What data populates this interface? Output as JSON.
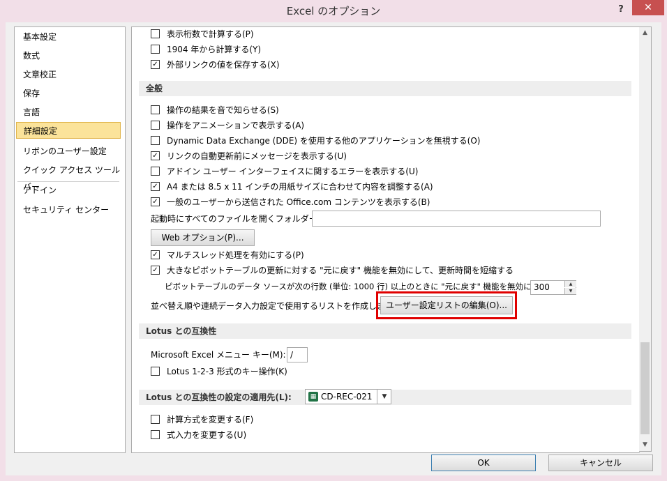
{
  "window": {
    "title": "Excel のオプション",
    "help": "?",
    "close": "✕"
  },
  "sidebar": {
    "items": [
      {
        "label": "基本設定"
      },
      {
        "label": "数式"
      },
      {
        "label": "文章校正"
      },
      {
        "label": "保存"
      },
      {
        "label": "言語"
      },
      {
        "label": "詳細設定",
        "selected": true
      },
      {
        "label": "リボンのユーザー設定"
      },
      {
        "label": "クイック アクセス ツール バー"
      },
      {
        "label": "アドイン"
      },
      {
        "label": "セキュリティ センター"
      }
    ]
  },
  "options_top": [
    {
      "label": "表示桁数で計算する(P)",
      "checked": false
    },
    {
      "label": "1904 年から計算する(Y)",
      "checked": false
    },
    {
      "label": "外部リンクの値を保存する(X)",
      "checked": true
    }
  ],
  "general": {
    "header": "全般",
    "options": [
      {
        "label": "操作の結果を音で知らせる(S)",
        "checked": false
      },
      {
        "label": "操作をアニメーションで表示する(A)",
        "checked": false
      },
      {
        "label": "Dynamic Data Exchange (DDE) を使用する他のアプリケーションを無視する(O)",
        "checked": false
      },
      {
        "label": "リンクの自動更新前にメッセージを表示する(U)",
        "checked": true
      },
      {
        "label": "アドイン ユーザー インターフェイスに関するエラーを表示する(U)",
        "checked": false
      },
      {
        "label": "A4 または 8.5 x 11 インチの用紙サイズに合わせて内容を調整する(A)",
        "checked": true
      },
      {
        "label": "一般のユーザーから送信された Office.com コンテンツを表示する(B)",
        "checked": true
      }
    ],
    "startup_folder_label": "起動時にすべてのファイルを開くフォルダー(L):",
    "startup_folder_value": "",
    "web_options_button": "Web オプション(P)...",
    "multithread": {
      "label": "マルチスレッド処理を有効にする(P)",
      "checked": true
    },
    "pivot_undo": {
      "label": "大きなピボットテーブルの更新に対する \"元に戻す\" 機能を無効にして、更新時間を短縮する",
      "checked": true
    },
    "pivot_rows_label": "ピボットテーブルのデータ ソースが次の行数 (単位: 1000 行) 以上のときに \"元に戻す\" 機能を無効にする:",
    "pivot_rows_value": "300",
    "custom_list_label": "並べ替え順や連続データ入力設定で使用するリストを作成します:",
    "custom_list_button": "ユーザー設定リストの編集(O)..."
  },
  "lotus": {
    "header": "Lotus との互換性",
    "menu_key_label": "Microsoft Excel メニュー キー(M):",
    "menu_key_value": "/",
    "transition_keys": {
      "label": "Lotus 1-2-3 形式のキー操作(K)",
      "checked": false
    }
  },
  "lotus_settings": {
    "header": "Lotus との互換性の設定の適用先(L):",
    "sheet": "CD-REC-021",
    "options": [
      {
        "label": "計算方式を変更する(F)",
        "checked": false
      },
      {
        "label": "式入力を変更する(U)",
        "checked": false
      }
    ]
  },
  "footer": {
    "ok": "OK",
    "cancel": "キャンセル"
  }
}
